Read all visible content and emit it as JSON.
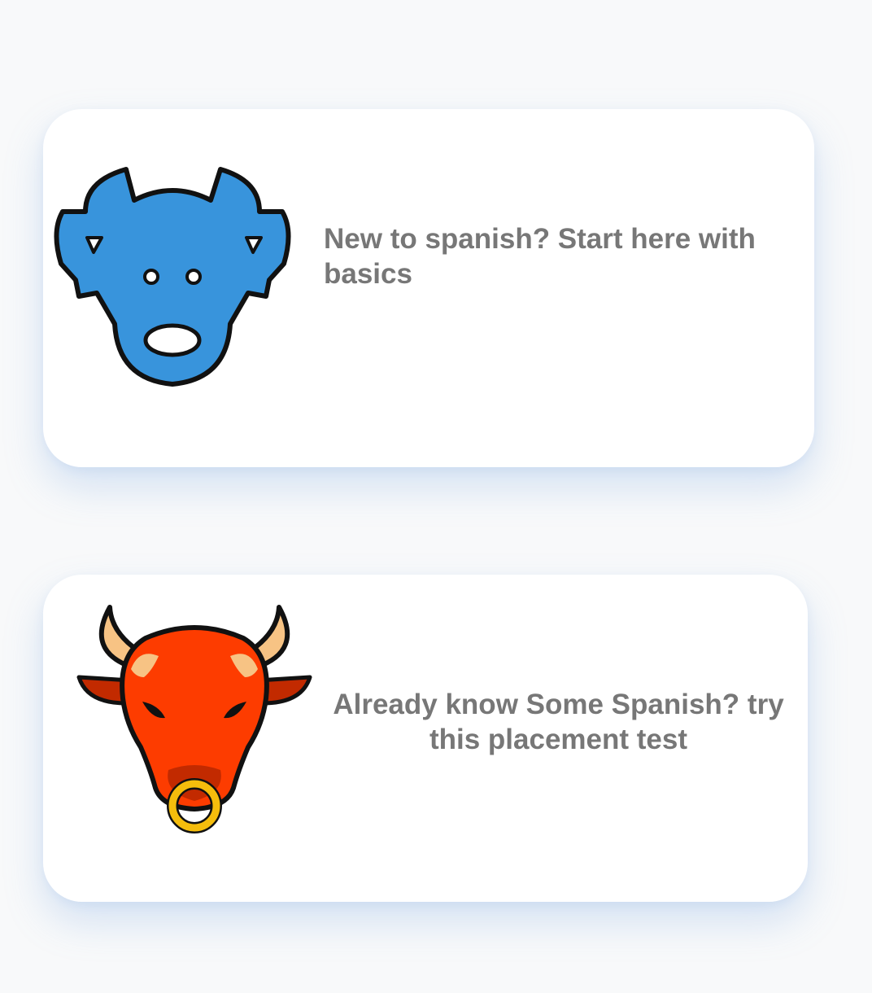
{
  "cards": [
    {
      "icon": "blue-bull-icon",
      "label": "New to spanish? Start here with basics"
    },
    {
      "icon": "red-bull-icon",
      "label": "Already know Some Spanish? try this placement test"
    }
  ],
  "colors": {
    "background": "#f8f9fa",
    "card": "#ffffff",
    "text": "#777777",
    "blue_bull": "#3894dc",
    "red_bull": "#fd3c00",
    "horn": "#f7c384",
    "nose_ring": "#f5bd0c"
  }
}
